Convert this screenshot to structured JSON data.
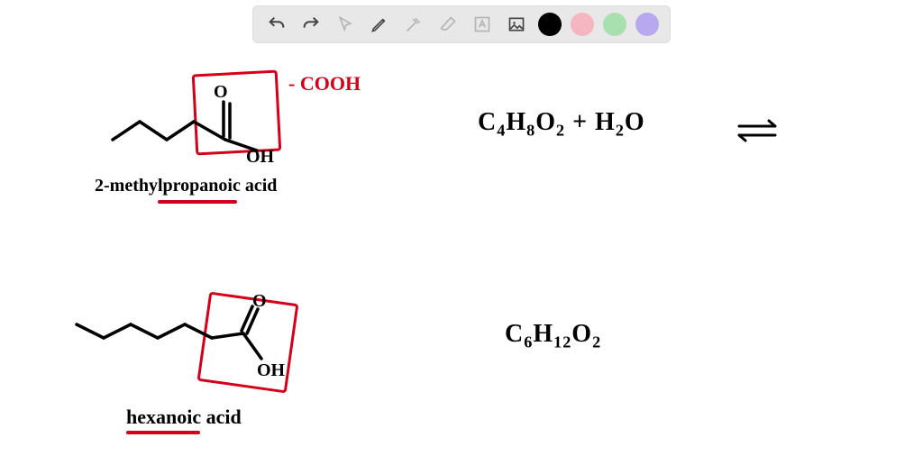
{
  "toolbar": {
    "tools": [
      {
        "name": "undo-icon",
        "title": "Undo"
      },
      {
        "name": "redo-icon",
        "title": "Redo"
      },
      {
        "name": "pointer-icon",
        "title": "Select"
      },
      {
        "name": "pen-icon",
        "title": "Pen"
      },
      {
        "name": "tools-icon",
        "title": "Tools"
      },
      {
        "name": "eraser-icon",
        "title": "Eraser"
      },
      {
        "name": "text-icon",
        "title": "Text"
      },
      {
        "name": "image-icon",
        "title": "Insert Image"
      }
    ],
    "colors": {
      "black": "#000000",
      "pink": "#f5b6c2",
      "green": "#a8e0b0",
      "purple": "#b8a8f0"
    }
  },
  "annotations": {
    "cooh_label": "- COOH",
    "compound1_name": "2-methylpropanoic acid",
    "compound2_name": "hexanoic acid",
    "formula1_parts": {
      "c": "C",
      "c_n": "4",
      "h": "H",
      "h_n": "8",
      "o": "O",
      "o_n": "2",
      "plus": " + H",
      "w_n": "2",
      "ow": "O"
    },
    "formula2_parts": {
      "c": "C",
      "c_n": "6",
      "h": "H",
      "h_n": "12",
      "o": "O",
      "o_n": "2"
    }
  }
}
